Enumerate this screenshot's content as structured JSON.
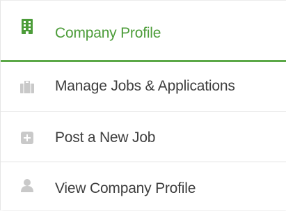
{
  "menu": {
    "items": [
      {
        "label": "Company Profile",
        "icon": "building-icon",
        "active": true
      },
      {
        "label": "Manage Jobs & Applications",
        "icon": "briefcase-icon",
        "active": false
      },
      {
        "label": "Post a New Job",
        "icon": "plus-square-icon",
        "active": false
      },
      {
        "label": "View Company Profile",
        "icon": "user-icon",
        "active": false
      }
    ]
  },
  "colors": {
    "accent": "#5ba847",
    "active_text": "#4c9c39",
    "text": "#3e3e3e",
    "icon_muted": "#c9c9c9",
    "divider": "#e3e3e3"
  }
}
